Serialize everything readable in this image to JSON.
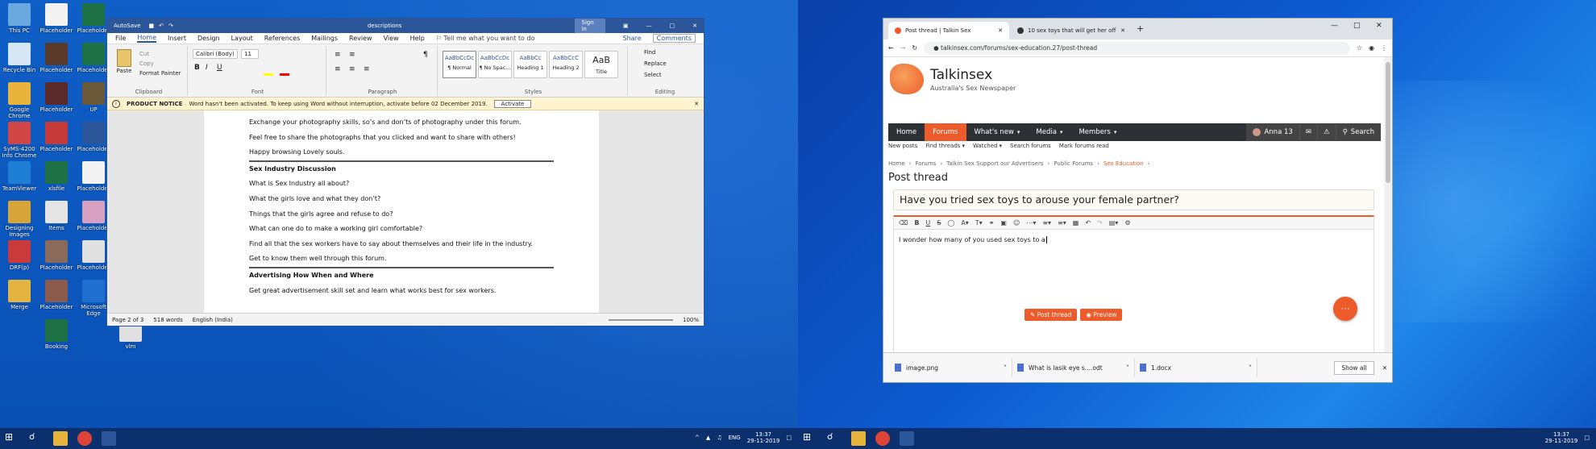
{
  "desktop": {
    "icons": [
      {
        "label": "This PC",
        "color": "#6aa9e0"
      },
      {
        "label": "Recycle Bin",
        "color": "#d7e6f5"
      },
      {
        "label": "Google Chrome",
        "color": "#e8b33a"
      },
      {
        "label": "SyMS-4200 Info Chrome",
        "color": "#d04545"
      },
      {
        "label": "TeamViewer",
        "color": "#1f7ed6"
      },
      {
        "label": "Designing Images",
        "color": "#d7a53a"
      },
      {
        "label": "DRF(p)",
        "color": "#c93a3a"
      },
      {
        "label": "Merge",
        "color": "#e3b441"
      },
      {
        "label": "Placeholder",
        "color": "#f2f2f2"
      },
      {
        "label": "Placeholder",
        "color": "#5a3a2a"
      },
      {
        "label": "Placeholder",
        "color": "#5a2a2a"
      },
      {
        "label": "Placeholder",
        "color": "#c73a3a"
      },
      {
        "label": "xlsfile",
        "color": "#1e7145"
      },
      {
        "label": "Items",
        "color": "#e5e5e5"
      },
      {
        "label": "Placeholder",
        "color": "#8a6a5a"
      },
      {
        "label": "Placeholder",
        "color": "#8a5a4a"
      },
      {
        "label": "Booking",
        "color": "#1e7145"
      },
      {
        "label": "Placeholder",
        "color": "#1e7145"
      },
      {
        "label": "Placeholder",
        "color": "#1e7145"
      },
      {
        "label": "UP",
        "color": "#6a5a3a"
      },
      {
        "label": "Placeholder",
        "color": "#2b579a"
      },
      {
        "label": "Placeholder",
        "color": "#f3f3f3"
      },
      {
        "label": "Placeholder",
        "color": "#d8a0c0"
      },
      {
        "label": "Placeholder",
        "color": "#e0e0e0"
      },
      {
        "label": "Microsoft Edge",
        "color": "#1f6fd0"
      },
      {
        "label": "vlm",
        "color": "#e0e0e0"
      }
    ],
    "taskbar_left": {
      "lang": "ENG",
      "time": "13:37",
      "date": "29-11-2019"
    },
    "taskbar_right": {
      "time": "13:37",
      "date": "29-11-2019"
    }
  },
  "word": {
    "title": "descriptions",
    "signin": "Sign in",
    "menu": [
      "File",
      "Home",
      "Insert",
      "Design",
      "Layout",
      "References",
      "Mailings",
      "Review",
      "View",
      "Help"
    ],
    "tellme": "Tell me what you want to do",
    "share": "Share",
    "comments": "Comments",
    "clipboard": {
      "paste": "Paste",
      "cut": "Cut",
      "copy": "Copy",
      "format_painter": "Format Painter",
      "label": "Clipboard"
    },
    "font": {
      "name": "Calibri (Body)",
      "size": "11",
      "label": "Font"
    },
    "paragraph_label": "Paragraph",
    "styles": [
      {
        "preview": "AaBbCcDc",
        "name": "¶ Normal"
      },
      {
        "preview": "AaBbCcDc",
        "name": "¶ No Spac..."
      },
      {
        "preview": "AaBbCc",
        "name": "Heading 1"
      },
      {
        "preview": "AaBbCcC",
        "name": "Heading 2"
      },
      {
        "preview": "AaB",
        "name": "Title"
      }
    ],
    "styles_label": "Styles",
    "editing": {
      "find": "Find",
      "replace": "Replace",
      "select": "Select",
      "label": "Editing"
    },
    "notice": {
      "title": "PRODUCT NOTICE",
      "text": "Word hasn't been activated. To keep using Word without interruption, activate before 02 December 2019.",
      "button": "Activate"
    },
    "paragraphs": [
      {
        "text": "Exchange your photography skills, so’s and don’ts of photography under this forum.",
        "style": ""
      },
      {
        "text": "Feel free to share the photographs that you clicked and want to share with others!",
        "style": ""
      },
      {
        "text": "Happy browsing Lovely souls.",
        "style": "rule"
      },
      {
        "text": "Sex Industry Discussion",
        "style": "h"
      },
      {
        "text": "What is Sex Industry all about?",
        "style": ""
      },
      {
        "text": "What the girls love and what they don’t?",
        "style": ""
      },
      {
        "text": "Things that the girls agree and refuse to do?",
        "style": ""
      },
      {
        "text": "What can one do to make a working girl comfortable?",
        "style": ""
      },
      {
        "text": "Find all that the sex workers have to say about themselves and their life in the industry.",
        "style": ""
      },
      {
        "text": "Get to know them well through this forum.",
        "style": "rule"
      },
      {
        "text": "Advertising How When and Where",
        "style": "h"
      },
      {
        "text": "Get great advertisement skill set and learn what works best for sex workers.",
        "style": ""
      }
    ],
    "status": {
      "page": "Page 2 of 3",
      "words": "518 words",
      "language": "English (India)",
      "zoom": "100%"
    }
  },
  "chrome": {
    "tabs": [
      {
        "title": "Post thread | Talkin Sex",
        "active": true
      },
      {
        "title": "10 sex toys that will get her off",
        "active": false
      }
    ],
    "url": "talkinsex.com/forums/sex-education.27/post-thread",
    "site": {
      "logo": "Talkinsex",
      "tagline": "Australia's Sex Newspaper",
      "nav": [
        {
          "label": "Home",
          "active": false
        },
        {
          "label": "Forums",
          "active": true
        },
        {
          "label": "What's new",
          "active": false
        },
        {
          "label": "Media",
          "active": false
        },
        {
          "label": "Members",
          "active": false
        }
      ],
      "user": "Anna 13",
      "search": "Search",
      "subnav": [
        "New posts",
        "Find threads",
        "Watched",
        "Search forums",
        "Mark forums read"
      ],
      "breadcrumb": [
        "Home",
        "Forums",
        "Talkin Sex Support our Advertisers",
        "Public Forums",
        "Sex Education"
      ],
      "page_title": "Post thread",
      "thread_title": "Have you tried sex toys to arouse your female partner?",
      "body": "I wonder how many of you used sex toys to a",
      "post_button": "Post thread",
      "preview_button": "Preview"
    },
    "downloads": [
      {
        "name": "image.png"
      },
      {
        "name": "What is lasik eye s....odt"
      },
      {
        "name": "1.docx"
      }
    ],
    "show_all": "Show all",
    "accent": "#ee5b2b"
  }
}
